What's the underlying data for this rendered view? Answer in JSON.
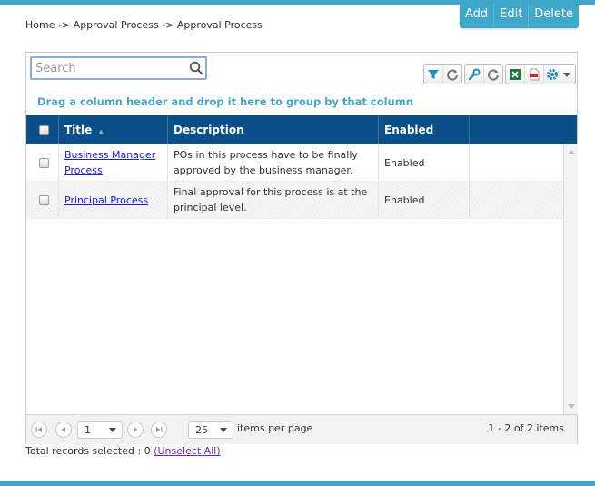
{
  "breadcrumb": "Home -> Approval Process -> Approval Process",
  "actions": {
    "add": "Add",
    "edit": "Edit",
    "delete": "Delete"
  },
  "toolbar": {
    "search_placeholder": "Search",
    "icons": [
      "filter-icon",
      "refresh-icon",
      "wrench-icon",
      "refresh-icon",
      "excel-icon",
      "pdf-icon",
      "gear-icon"
    ]
  },
  "grid": {
    "group_hint": "Drag a column header and drop it here to group by that column",
    "columns": [
      "Title",
      "Description",
      "Enabled"
    ],
    "sort_indicator": "▲",
    "rows": [
      {
        "title": "Business Manager Process",
        "description": "POs in this process have to be finally approved by the business manager.",
        "enabled": "Enabled"
      },
      {
        "title": "Principal Process",
        "description": "Final approval for this process is at the principal level.",
        "enabled": "Enabled"
      }
    ]
  },
  "pager": {
    "page": "1",
    "page_size": "25",
    "items_per_page_label": "items per page",
    "info": "1 - 2 of 2 items"
  },
  "footer": {
    "total_selected_label": "Total records selected : 0",
    "unselect_all": "(Unselect All)"
  },
  "colors": {
    "header": "#0a4f87",
    "accent": "#3fa7c9",
    "link": "#1a1adc"
  }
}
